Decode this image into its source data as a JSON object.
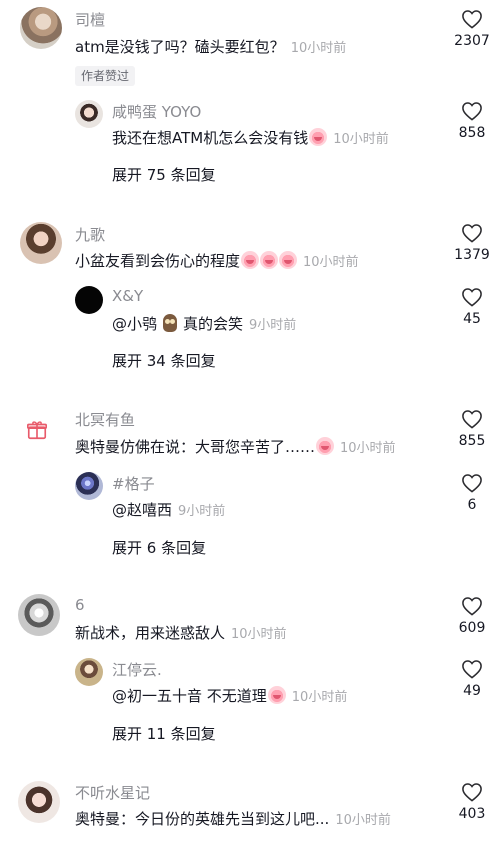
{
  "comments": [
    {
      "user": "司檀",
      "text": "atm是没钱了吗？磕头要红包？",
      "time": "10小时前",
      "tag": "作者赞过",
      "likes": "2307",
      "reply": {
        "user": "咸鸭蛋 YOYO",
        "text": "我还在想ATM机怎么会没有钱",
        "time": "10小时前",
        "likes": "858"
      },
      "expand": "展开 75 条回复"
    },
    {
      "user": "九歌",
      "text": "小盆友看到会伤心的程度",
      "time": "10小时前",
      "likes": "1379",
      "reply": {
        "user": "X&Y",
        "text_a": "@小鸮",
        "text_b": "真的会笑",
        "time": "9小时前",
        "likes": "45"
      },
      "expand": "展开 34 条回复"
    },
    {
      "user": "北冥有鱼",
      "text": "奥特曼仿佛在说：大哥您辛苦了……",
      "time": "10小时前",
      "likes": "855",
      "reply": {
        "user": "#格子",
        "text": "@赵嘻西",
        "time": "9小时前",
        "likes": "6"
      },
      "expand": "展开 6 条回复"
    },
    {
      "user": "6",
      "text": "新战术，用来迷惑敌人",
      "time": "10小时前",
      "likes": "609",
      "reply": {
        "user": "江停云.",
        "text": "@初一五十音 不无道理",
        "time": "10小时前",
        "likes": "49"
      },
      "expand": "展开 11 条回复"
    },
    {
      "user": "不听水星记",
      "text": "奥特曼：今日份的英雄先当到这儿吧...",
      "time": "10小时前",
      "likes": "403"
    }
  ],
  "icons": {
    "like": "heart-outline-icon",
    "gift": "gift-icon"
  },
  "colors": {
    "username": "#8a8b91",
    "time": "#a8a9ad",
    "text": "#161823"
  }
}
